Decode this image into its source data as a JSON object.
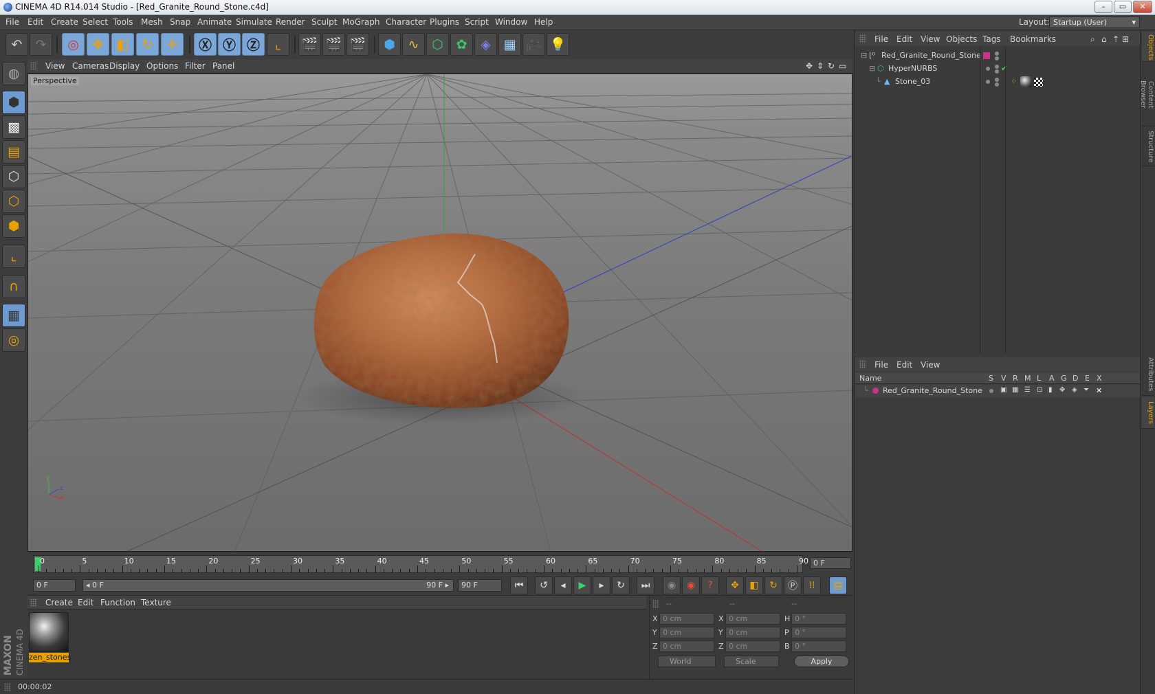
{
  "titlebar": {
    "title": "CINEMA 4D R14.014 Studio - [Red_Granite_Round_Stone.c4d]",
    "min": "–",
    "max": "▭",
    "close": "✕"
  },
  "menubar": {
    "items": [
      "File",
      "Edit",
      "Create",
      "Select",
      "Tools",
      "Mesh",
      "Snap",
      "Animate",
      "Simulate",
      "Render",
      "Sculpt",
      "MoGraph",
      "Character",
      "Plugins",
      "Script",
      "Window",
      "Help"
    ],
    "layout_label": "Layout:",
    "layout_value": "Startup (User)"
  },
  "viewport": {
    "menu": [
      "View",
      "Cameras",
      "Display",
      "Options",
      "Filter",
      "Panel"
    ],
    "label": "Perspective",
    "axis_y": "y",
    "axis_z": "z",
    "axis_x": "x"
  },
  "timeline": {
    "ticks": [
      "0",
      "5",
      "10",
      "15",
      "20",
      "25",
      "30",
      "35",
      "40",
      "45",
      "50",
      "55",
      "60",
      "65",
      "70",
      "75",
      "80",
      "85",
      "90"
    ],
    "current": "0 F"
  },
  "transport": {
    "start": "0 F",
    "range_start": "◂ 0 F",
    "range_end": "90 F ▸",
    "end": "90 F"
  },
  "materials": {
    "menu": [
      "Create",
      "Edit",
      "Function",
      "Texture"
    ],
    "items": [
      {
        "name": "zen_stones"
      }
    ]
  },
  "coords": {
    "header": [
      "--",
      "--",
      "--"
    ],
    "rows": [
      {
        "l1": "X",
        "v1": "0 cm",
        "l2": "X",
        "v2": "0 cm",
        "l3": "H",
        "v3": "0 °"
      },
      {
        "l1": "Y",
        "v1": "0 cm",
        "l2": "Y",
        "v2": "0 cm",
        "l3": "P",
        "v3": "0 °"
      },
      {
        "l1": "Z",
        "v1": "0 cm",
        "l2": "Z",
        "v2": "0 cm",
        "l3": "B",
        "v3": "0 °"
      }
    ],
    "mode": "World",
    "size": "Scale",
    "apply": "Apply"
  },
  "status": {
    "time": "00:00:02"
  },
  "branding": {
    "maxon": "MAXON",
    "cinema": "CINEMA 4D"
  },
  "objects": {
    "menu": [
      "File",
      "Edit",
      "View",
      "Objects",
      "Tags",
      "Bookmarks"
    ],
    "rows": [
      {
        "name": "Red_Granite_Round_Stone"
      },
      {
        "name": "HyperNURBS"
      },
      {
        "name": "Stone_03"
      }
    ]
  },
  "layers": {
    "menu": [
      "File",
      "Edit",
      "View"
    ],
    "headers": {
      "name": "Name",
      "cols": [
        "S",
        "V",
        "R",
        "M",
        "L",
        "A",
        "G",
        "D",
        "E",
        "X"
      ]
    },
    "rows": [
      {
        "name": "Red_Granite_Round_Stone"
      }
    ]
  },
  "right_tabs": [
    "Objects",
    "Content Browser",
    "Structure",
    "Attributes",
    "Layers"
  ],
  "colors": {
    "accent": "#e8a200",
    "layer_color": "#c8348c",
    "x_axis": "#c03030",
    "y_axis": "#30b030",
    "z_axis": "#3040c0"
  }
}
